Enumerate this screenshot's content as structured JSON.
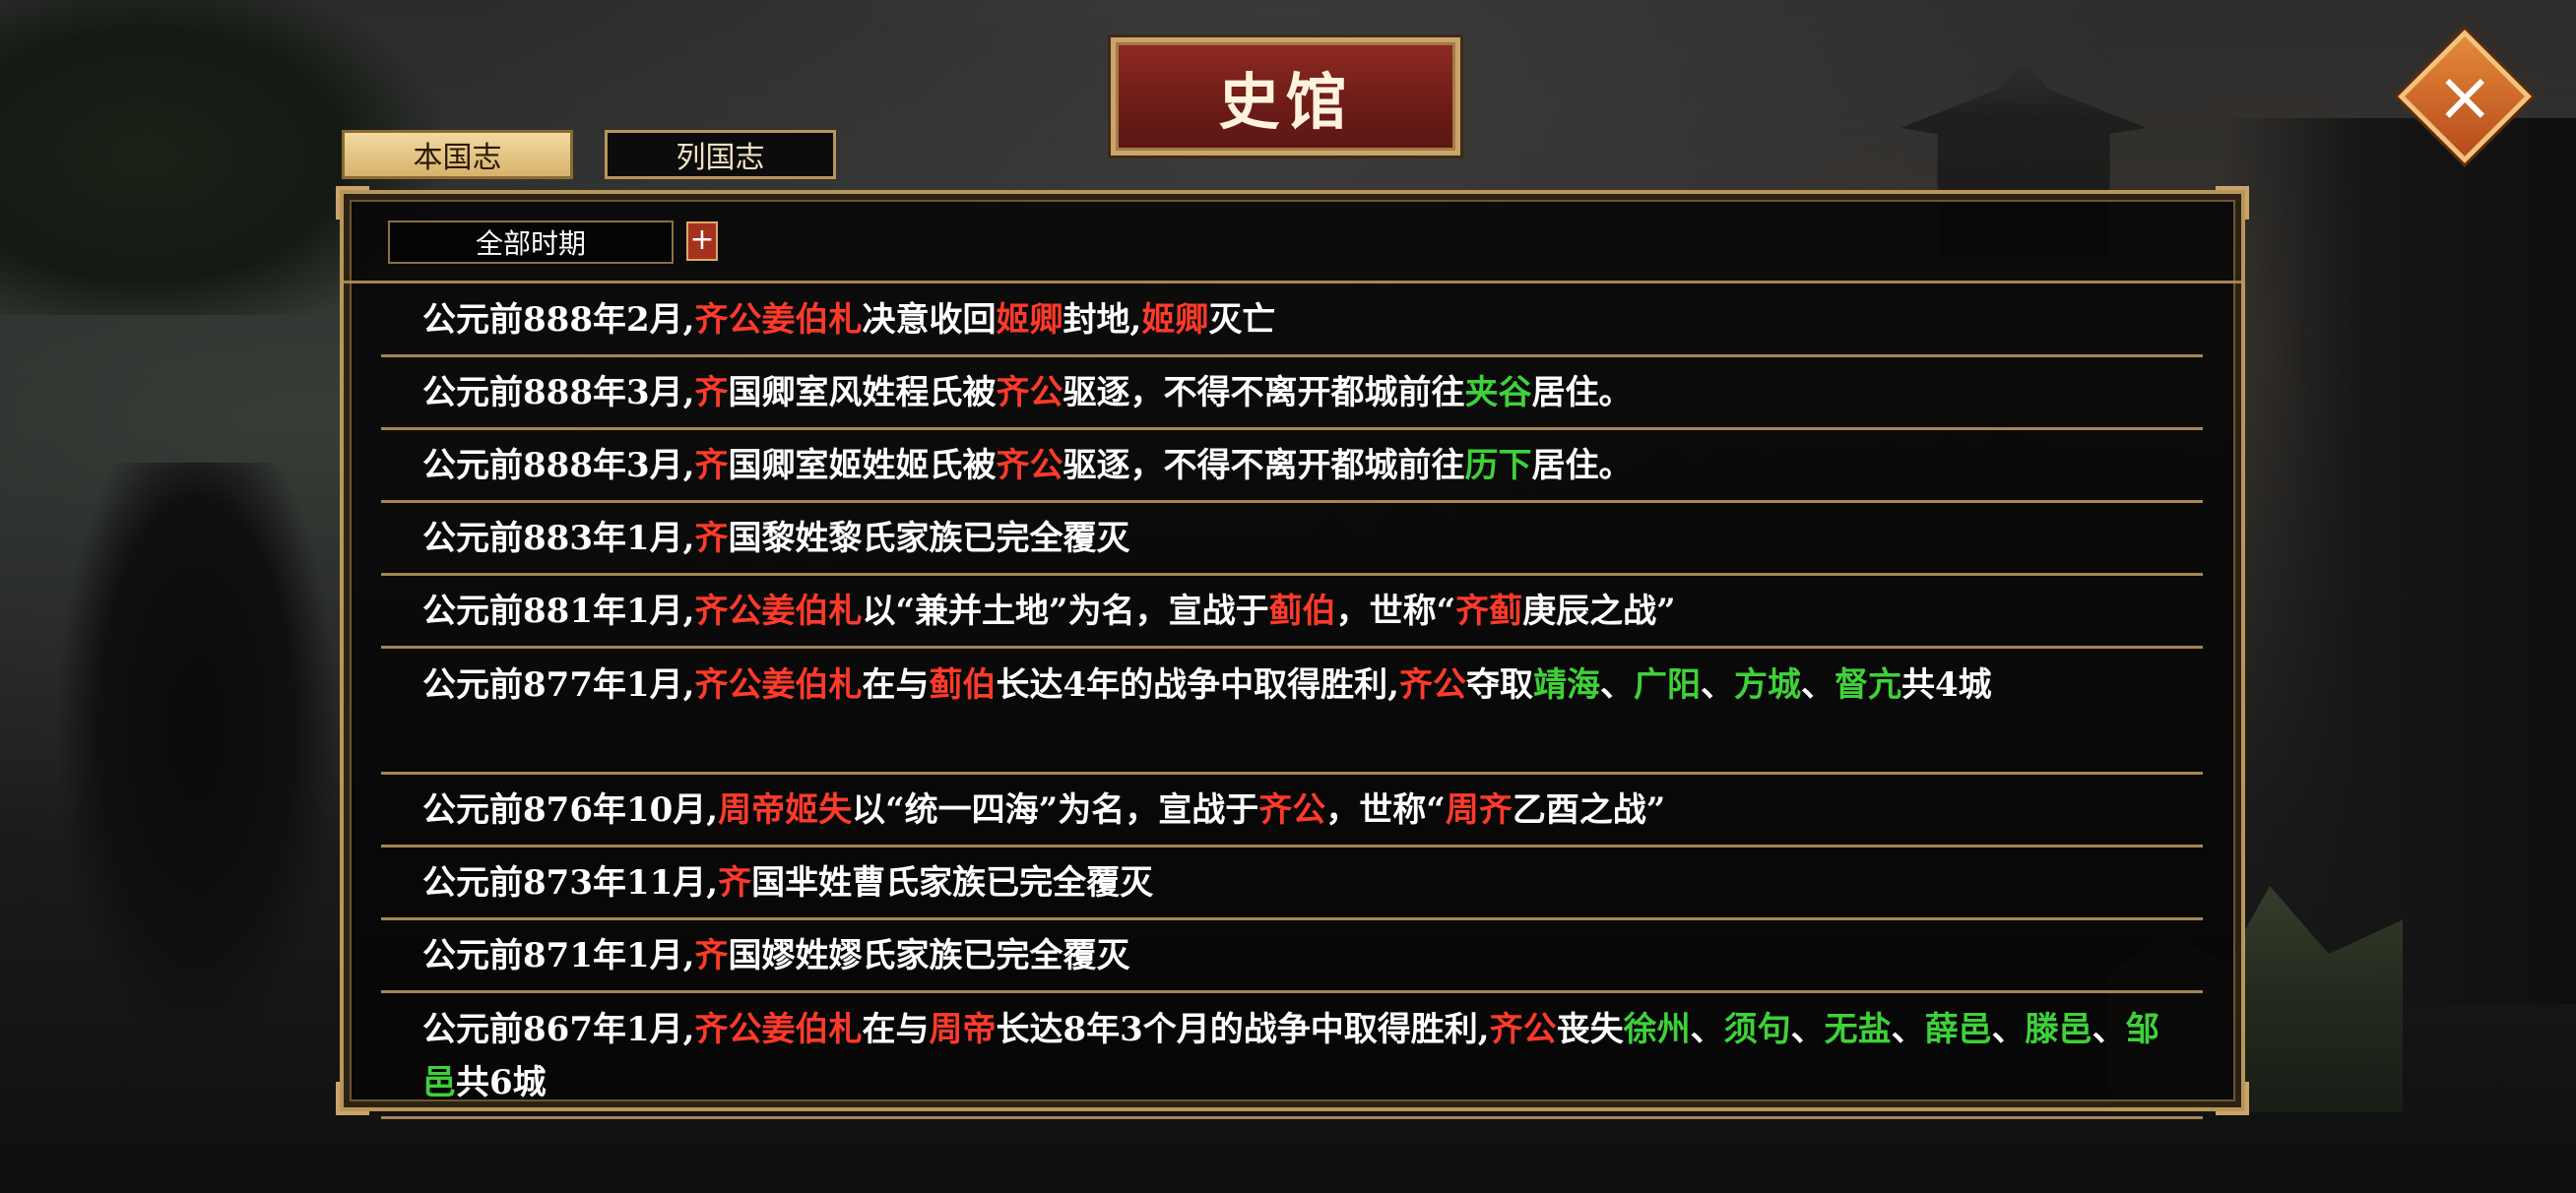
{
  "title": "史馆",
  "tabs": [
    {
      "label": "本国志",
      "active": true
    },
    {
      "label": "列国志",
      "active": false
    }
  ],
  "filter": {
    "selected": "全部时期",
    "plus": "+"
  },
  "colors": {
    "red": "#ff3a2a",
    "green": "#3fd13a",
    "white": "#ffffff",
    "gold": "#b99658"
  },
  "icons": {
    "close": "close-icon"
  },
  "records": [
    {
      "segments": [
        {
          "t": "公元前888年2月,",
          "c": "w"
        },
        {
          "t": "齐公姜伯札",
          "c": "r"
        },
        {
          "t": "决意收回",
          "c": "w"
        },
        {
          "t": "姬卿",
          "c": "r"
        },
        {
          "t": "封地,",
          "c": "w"
        },
        {
          "t": "姬卿",
          "c": "r"
        },
        {
          "t": "灭亡",
          "c": "w"
        }
      ]
    },
    {
      "segments": [
        {
          "t": "公元前888年3月,",
          "c": "w"
        },
        {
          "t": "齐",
          "c": "r"
        },
        {
          "t": "国卿室风姓程氏被",
          "c": "w"
        },
        {
          "t": "齐公",
          "c": "r"
        },
        {
          "t": "驱逐，不得不离开都城前往",
          "c": "w"
        },
        {
          "t": "夹谷",
          "c": "g"
        },
        {
          "t": "居住。",
          "c": "w"
        }
      ]
    },
    {
      "segments": [
        {
          "t": "公元前888年3月,",
          "c": "w"
        },
        {
          "t": "齐",
          "c": "r"
        },
        {
          "t": "国卿室姬姓姬氏被",
          "c": "w"
        },
        {
          "t": "齐公",
          "c": "r"
        },
        {
          "t": "驱逐，不得不离开都城前往",
          "c": "w"
        },
        {
          "t": "历下",
          "c": "g"
        },
        {
          "t": "居住。",
          "c": "w"
        }
      ]
    },
    {
      "segments": [
        {
          "t": "公元前883年1月,",
          "c": "w"
        },
        {
          "t": "齐",
          "c": "r"
        },
        {
          "t": "国黎姓黎氏家族已完全覆灭",
          "c": "w"
        }
      ]
    },
    {
      "segments": [
        {
          "t": "公元前881年1月,",
          "c": "w"
        },
        {
          "t": "齐公姜伯札",
          "c": "r"
        },
        {
          "t": "以“兼并土地”为名，宣战于",
          "c": "w"
        },
        {
          "t": "蓟伯",
          "c": "r"
        },
        {
          "t": "，世称“",
          "c": "w"
        },
        {
          "t": "齐蓟",
          "c": "r"
        },
        {
          "t": "庚辰之战”",
          "c": "w"
        }
      ]
    },
    {
      "segments": [
        {
          "t": "公元前877年1月,",
          "c": "w"
        },
        {
          "t": "齐公姜伯札",
          "c": "r"
        },
        {
          "t": "在与",
          "c": "w"
        },
        {
          "t": "蓟伯",
          "c": "r"
        },
        {
          "t": "长达4年的战争中取得胜利,",
          "c": "w"
        },
        {
          "t": "齐公",
          "c": "r"
        },
        {
          "t": "夺取",
          "c": "w"
        },
        {
          "t": "靖海",
          "c": "g"
        },
        {
          "t": "、",
          "c": "w"
        },
        {
          "t": "广阳",
          "c": "g"
        },
        {
          "t": "、",
          "c": "w"
        },
        {
          "t": "方城",
          "c": "g"
        },
        {
          "t": "、",
          "c": "w"
        },
        {
          "t": "督亢",
          "c": "g"
        },
        {
          "t": "共4城",
          "c": "w"
        }
      ]
    },
    {
      "segments": [
        {
          "t": "公元前876年10月,",
          "c": "w"
        },
        {
          "t": "周帝姬失",
          "c": "r"
        },
        {
          "t": "以“统一四海”为名，宣战于",
          "c": "w"
        },
        {
          "t": "齐公",
          "c": "r"
        },
        {
          "t": "，世称“",
          "c": "w"
        },
        {
          "t": "周齐",
          "c": "r"
        },
        {
          "t": "乙酉之战”",
          "c": "w"
        }
      ]
    },
    {
      "segments": [
        {
          "t": "公元前873年11月,",
          "c": "w"
        },
        {
          "t": "齐",
          "c": "r"
        },
        {
          "t": "国芈姓曹氏家族已完全覆灭",
          "c": "w"
        }
      ]
    },
    {
      "segments": [
        {
          "t": "公元前871年1月,",
          "c": "w"
        },
        {
          "t": "齐",
          "c": "r"
        },
        {
          "t": "国嫪姓嫪氏家族已完全覆灭",
          "c": "w"
        }
      ]
    },
    {
      "segments": [
        {
          "t": "公元前867年1月,",
          "c": "w"
        },
        {
          "t": "齐公姜伯札",
          "c": "r"
        },
        {
          "t": "在与",
          "c": "w"
        },
        {
          "t": "周帝",
          "c": "r"
        },
        {
          "t": "长达8年3个月的战争中取得胜利,",
          "c": "w"
        },
        {
          "t": "齐公",
          "c": "r"
        },
        {
          "t": "丧失",
          "c": "w"
        },
        {
          "t": "徐州",
          "c": "g"
        },
        {
          "t": "、",
          "c": "w"
        },
        {
          "t": "须句",
          "c": "g"
        },
        {
          "t": "、",
          "c": "w"
        },
        {
          "t": "无盐",
          "c": "g"
        },
        {
          "t": "、",
          "c": "w"
        },
        {
          "t": "薛邑",
          "c": "g"
        },
        {
          "t": "、",
          "c": "w"
        },
        {
          "t": "滕邑",
          "c": "g"
        },
        {
          "t": "、",
          "c": "w"
        },
        {
          "t": "邹邑",
          "c": "g"
        },
        {
          "t": "共6城",
          "c": "w"
        }
      ]
    }
  ]
}
